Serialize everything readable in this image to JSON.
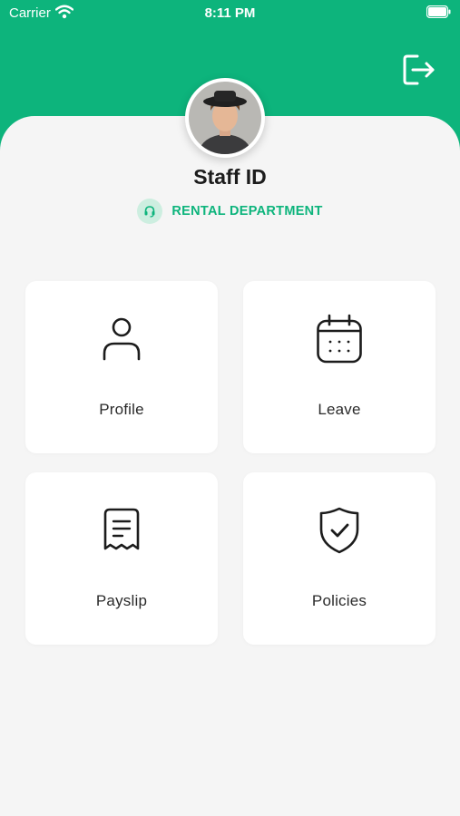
{
  "status_bar": {
    "carrier": "Carrier",
    "time": "8:11 PM"
  },
  "header": {
    "logout_icon": "logout-icon",
    "brand_color": "#0db47c"
  },
  "profile": {
    "staff_id": "Staff ID",
    "department": "RENTAL DEPARTMENT",
    "department_icon": "headset-icon"
  },
  "menu": {
    "items": [
      {
        "label": "Profile",
        "icon": "user-icon"
      },
      {
        "label": "Leave",
        "icon": "calendar-icon"
      },
      {
        "label": "Payslip",
        "icon": "receipt-icon"
      },
      {
        "label": "Policies",
        "icon": "shield-check-icon"
      }
    ]
  }
}
